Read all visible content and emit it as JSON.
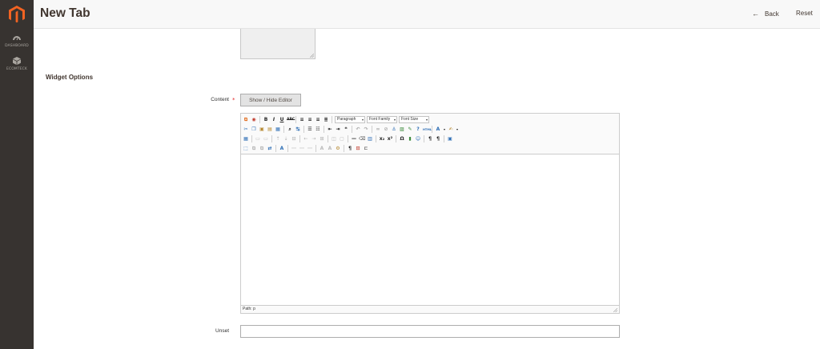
{
  "sidebar": {
    "items": [
      {
        "label": "DASHBOARD",
        "icon": "dashboard-icon"
      },
      {
        "label": "ECOMTECK",
        "icon": "cube-icon"
      }
    ]
  },
  "header": {
    "title": "New Tab",
    "back_label": "Back",
    "reset_label": "Reset"
  },
  "section": {
    "title": "Widget Options"
  },
  "content_field": {
    "label": "Content",
    "required_mark": "*",
    "toggle_label": "Show / Hide Editor"
  },
  "editor": {
    "toolbar": {
      "format_select": "Paragraph",
      "font_family_select": "Font Family",
      "font_size_select": "Font Size"
    },
    "status_path": "Path: p"
  },
  "unset_field": {
    "label": "Unset",
    "value": ""
  },
  "colors": {
    "sidebar_bg": "#373330",
    "header_bg": "#f8f8f8",
    "brand_orange": "#f26322",
    "required_red": "#e22626"
  }
}
